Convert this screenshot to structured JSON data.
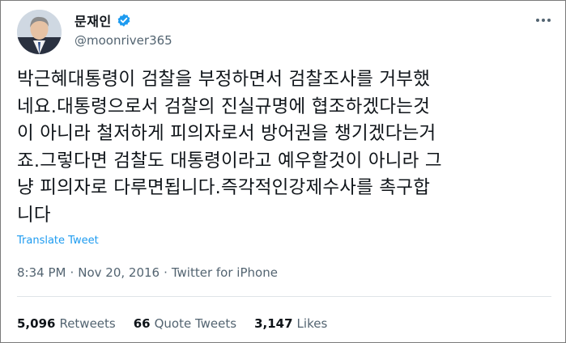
{
  "author": {
    "display_name": "문재인",
    "handle": "@moonriver365",
    "verified_icon": "verified-badge-icon",
    "avatar_icon": "profile-avatar"
  },
  "more_icon": "more-options-icon",
  "tweet": {
    "lines": [
      "박근혜대통령이 검찰을 부정하면서 검찰조사를 거부했",
      "네요.대통령으로서 검찰의 진실규명에 협조하겠다는것",
      "이 아니라 철저하게 피의자로서 방어권을 챙기겠다는거",
      "죠.그렇다면 검찰도 대통령이라고 예우할것이 아니라 그",
      "냥 피의자로 다루면됩니다.즉각적인강제수사를 촉구합",
      "니다"
    ],
    "translate_label": "Translate Tweet",
    "time": "8:34 PM",
    "separator": "·",
    "date": "Nov 20, 2016",
    "source": "Twitter for iPhone"
  },
  "stats": {
    "retweets_count": "5,096",
    "retweets_label": "Retweets",
    "quotes_count": "66",
    "quotes_label": "Quote Tweets",
    "likes_count": "3,147",
    "likes_label": "Likes"
  },
  "colors": {
    "link_blue": "#1d9bf0",
    "muted_gray": "#536471",
    "text": "#0f1419",
    "divider": "#dfe4e8"
  }
}
